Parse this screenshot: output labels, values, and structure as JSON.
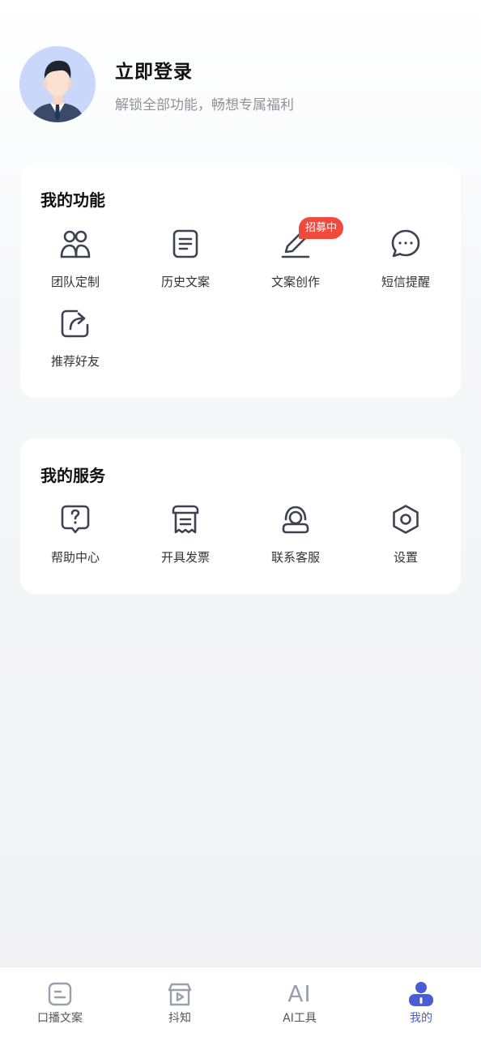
{
  "profile": {
    "title": "立即登录",
    "subtitle": "解锁全部功能，畅想专属福利"
  },
  "features": {
    "title": "我的功能",
    "items": [
      {
        "label": "团队定制",
        "icon": "team-icon"
      },
      {
        "label": "历史文案",
        "icon": "document-list-icon"
      },
      {
        "label": "文案创作",
        "icon": "pen-icon",
        "badge": "招募中"
      },
      {
        "label": "短信提醒",
        "icon": "chat-bubble-icon"
      },
      {
        "label": "推荐好友",
        "icon": "share-icon"
      }
    ]
  },
  "services": {
    "title": "我的服务",
    "items": [
      {
        "label": "帮助中心",
        "icon": "help-icon"
      },
      {
        "label": "开具发票",
        "icon": "invoice-icon"
      },
      {
        "label": "联系客服",
        "icon": "customer-service-icon"
      },
      {
        "label": "设置",
        "icon": "settings-icon"
      }
    ]
  },
  "tabbar": {
    "active": "我的",
    "items": [
      {
        "label": "口播文案",
        "icon": "script-icon"
      },
      {
        "label": "抖知",
        "icon": "video-store-icon"
      },
      {
        "label": "AI工具",
        "icon": "ai-icon",
        "icon_text": "AI"
      },
      {
        "label": "我的",
        "icon": "profile-icon"
      }
    ]
  },
  "colors": {
    "accent": "#4a5bd6",
    "badge": "#f04a3e",
    "icon_stroke": "#3d4250",
    "avatar_bg": "#c9d7fb"
  }
}
